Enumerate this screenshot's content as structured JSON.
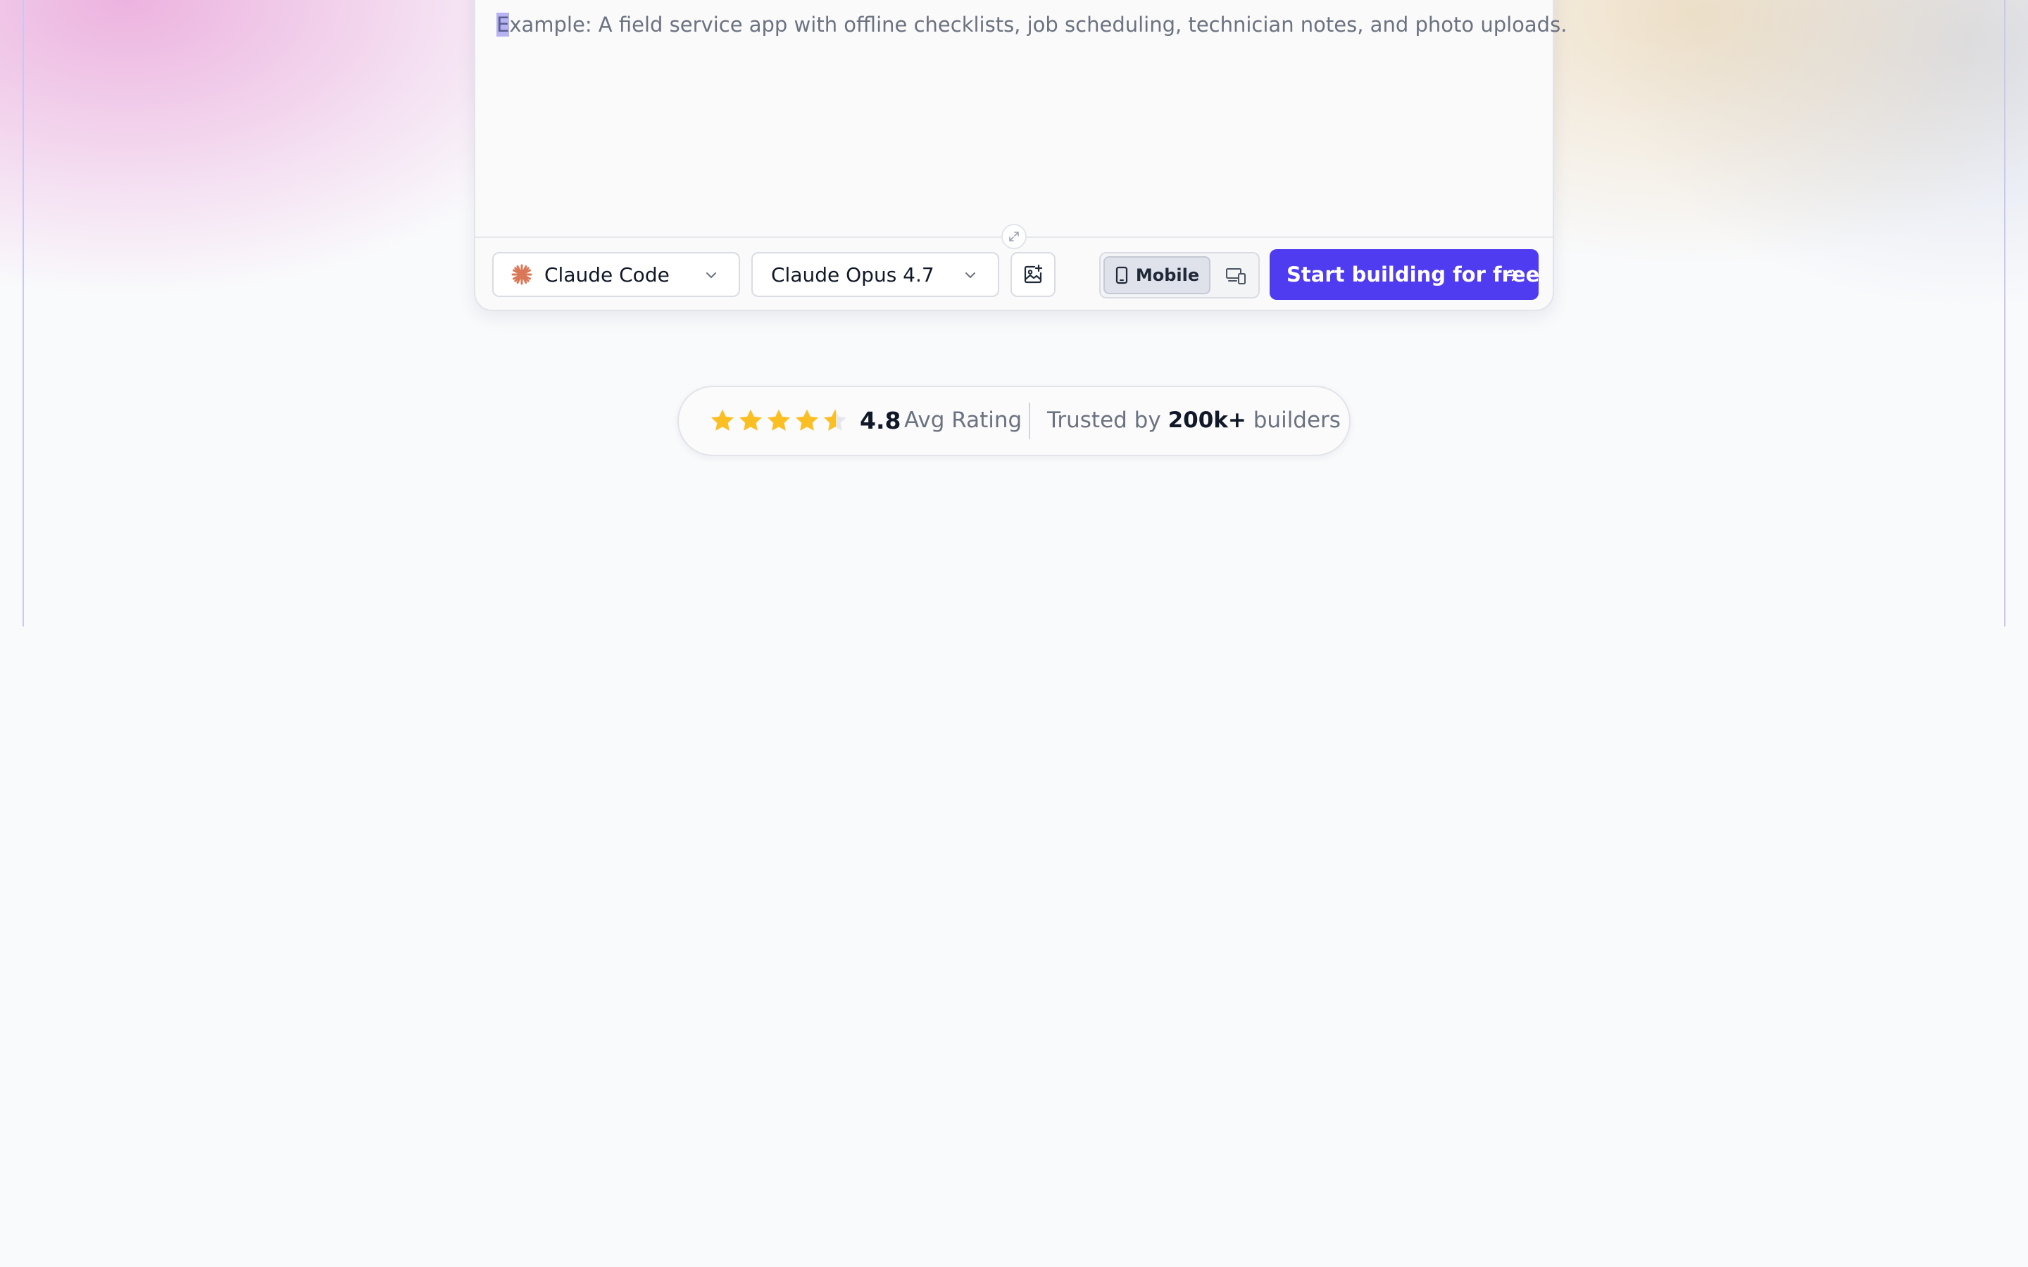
{
  "prompt": {
    "placeholder": "Example: A field service app with offline checklists, job scheduling, technician notes, and photo uploads.",
    "caret_char": "E",
    "placeholder_rest": "xample: A field service app with offline checklists, job scheduling, technician notes, and photo uploads."
  },
  "toolbar": {
    "agent_select": {
      "value": "Claude Code",
      "icon": "claude-logo-icon"
    },
    "model_select": {
      "value": "Claude Opus 4.7"
    },
    "image_button_icon": "image-plus-icon",
    "device_toggle": {
      "mobile_label": "Mobile",
      "selected": "Mobile",
      "desktop_icon": "devices-icon"
    },
    "cta_label": "Start building for free",
    "cta_icon": "arrow-right-icon"
  },
  "rating": {
    "stars_value": 4.8,
    "stars_max": 5,
    "value": "4.8",
    "label": "Avg Rating",
    "trusted_prefix": "Trusted by",
    "trusted_count": "200k+",
    "trusted_suffix": "builders"
  },
  "colors": {
    "accent": "#4f3bf0",
    "star": "#fbbf24",
    "star_empty": "#e5e7eb",
    "claude_logo": "#d97757"
  }
}
